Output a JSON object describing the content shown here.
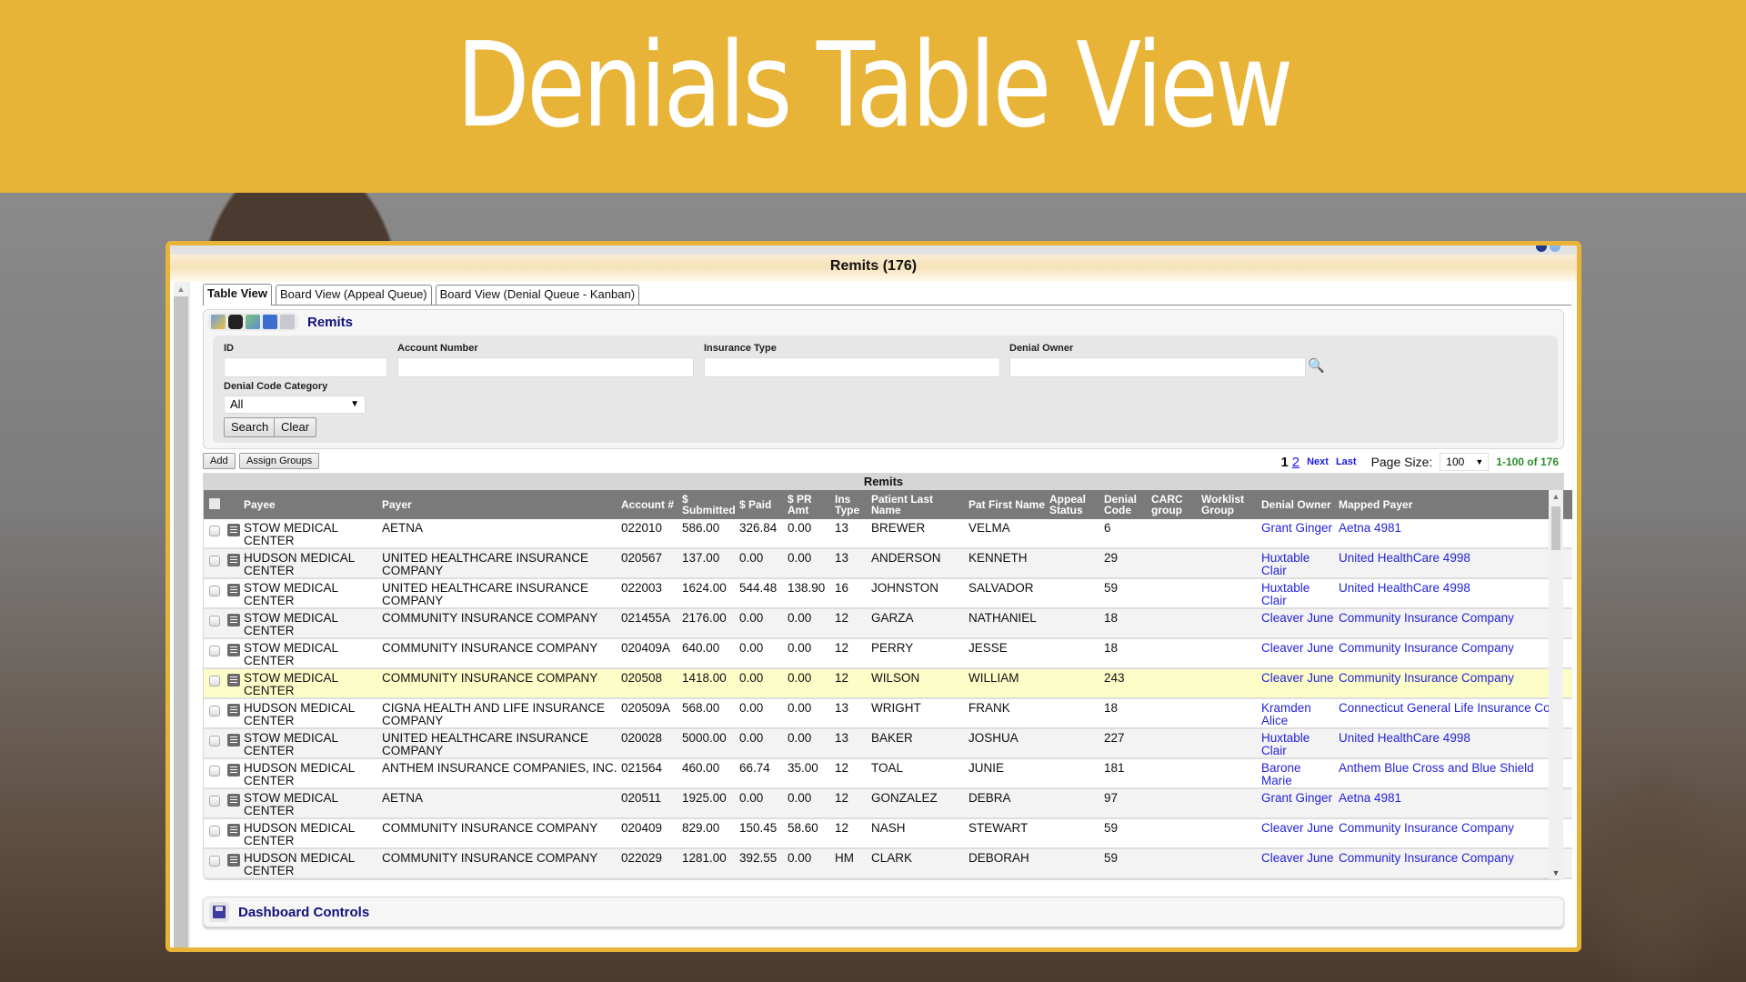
{
  "banner": {
    "title": "Denials Table View"
  },
  "colors": {
    "banner": "#e8b438",
    "link": "#2424d8",
    "title_blue": "#11117a",
    "range_green": "#2a8a2a",
    "highlight_row": "#fdfdc8"
  },
  "window": {
    "title": "Remits (176)"
  },
  "tabs": [
    {
      "label": "Table View",
      "active": true
    },
    {
      "label": "Board View (Appeal Queue)",
      "active": false
    },
    {
      "label": "Board View (Denial Queue - Kanban)",
      "active": false
    }
  ],
  "toolbar": {
    "icons": [
      "edit-icon",
      "binoculars-icon",
      "export-excel-icon",
      "save-icon",
      "checklist-icon"
    ],
    "title": "Remits"
  },
  "filters": {
    "id_label": "ID",
    "id_value": "",
    "account_label": "Account Number",
    "account_value": "",
    "insurance_label": "Insurance Type",
    "insurance_value": "",
    "owner_label": "Denial Owner",
    "owner_value": "",
    "category_label": "Denial Code Category",
    "category_value": "All",
    "search_label": "Search",
    "clear_label": "Clear"
  },
  "actions": {
    "add_label": "Add",
    "assign_label": "Assign Groups"
  },
  "pager": {
    "current": "1",
    "page2": "2",
    "next": "Next",
    "last": "Last",
    "page_size_label": "Page Size:",
    "page_size": "100",
    "range": "1-100 of 176"
  },
  "grid": {
    "caption": "Remits",
    "columns": [
      "Payee",
      "Payer",
      "Account #",
      "$ Submitted",
      "$ Paid",
      "$ PR Amt",
      "Ins Type",
      "Patient Last Name",
      "Pat First Name",
      "Appeal Status",
      "Denial Code",
      "CARC group",
      "Worklist Group",
      "Denial Owner",
      "Mapped Payer"
    ],
    "rows": [
      {
        "payee": "STOW MEDICAL CENTER",
        "payer": "AETNA",
        "account": "022010",
        "submitted": "586.00",
        "paid": "326.84",
        "pr": "0.00",
        "ins": "13",
        "last": "BREWER",
        "first": "VELMA",
        "appeal": "",
        "code": "6",
        "carc": "",
        "worklist": "",
        "owner": "Grant Ginger",
        "mapped": "Aetna 4981",
        "highlight": false
      },
      {
        "payee": "HUDSON MEDICAL CENTER",
        "payer": "UNITED HEALTHCARE INSURANCE COMPANY",
        "account": "020567",
        "submitted": "137.00",
        "paid": "0.00",
        "pr": "0.00",
        "ins": "13",
        "last": "ANDERSON",
        "first": "KENNETH",
        "appeal": "",
        "code": "29",
        "carc": "",
        "worklist": "",
        "owner": "Huxtable Clair",
        "mapped": "United HealthCare 4998",
        "highlight": false
      },
      {
        "payee": "STOW MEDICAL CENTER",
        "payer": "UNITED HEALTHCARE INSURANCE COMPANY",
        "account": "022003",
        "submitted": "1624.00",
        "paid": "544.48",
        "pr": "138.90",
        "ins": "16",
        "last": "JOHNSTON",
        "first": "SALVADOR",
        "appeal": "",
        "code": "59",
        "carc": "",
        "worklist": "",
        "owner": "Huxtable Clair",
        "mapped": "United HealthCare 4998",
        "highlight": false
      },
      {
        "payee": "STOW MEDICAL CENTER",
        "payer": "COMMUNITY INSURANCE COMPANY",
        "account": "021455A",
        "submitted": "2176.00",
        "paid": "0.00",
        "pr": "0.00",
        "ins": "12",
        "last": "GARZA",
        "first": "NATHANIEL",
        "appeal": "",
        "code": "18",
        "carc": "",
        "worklist": "",
        "owner": "Cleaver June",
        "mapped": "Community Insurance Company",
        "highlight": false
      },
      {
        "payee": "STOW MEDICAL CENTER",
        "payer": "COMMUNITY INSURANCE COMPANY",
        "account": "020409A",
        "submitted": "640.00",
        "paid": "0.00",
        "pr": "0.00",
        "ins": "12",
        "last": "PERRY",
        "first": "JESSE",
        "appeal": "",
        "code": "18",
        "carc": "",
        "worklist": "",
        "owner": "Cleaver June",
        "mapped": "Community Insurance Company",
        "highlight": false
      },
      {
        "payee": "STOW MEDICAL CENTER",
        "payer": "COMMUNITY INSURANCE COMPANY",
        "account": "020508",
        "submitted": "1418.00",
        "paid": "0.00",
        "pr": "0.00",
        "ins": "12",
        "last": "WILSON",
        "first": "WILLIAM",
        "appeal": "",
        "code": "243",
        "carc": "",
        "worklist": "",
        "owner": "Cleaver June",
        "mapped": "Community Insurance Company",
        "highlight": true
      },
      {
        "payee": "HUDSON MEDICAL CENTER",
        "payer": "CIGNA HEALTH AND LIFE INSURANCE COMPANY",
        "account": "020509A",
        "submitted": "568.00",
        "paid": "0.00",
        "pr": "0.00",
        "ins": "13",
        "last": "WRIGHT",
        "first": "FRANK",
        "appeal": "",
        "code": "18",
        "carc": "",
        "worklist": "",
        "owner": "Kramden Alice",
        "mapped": "Connecticut General Life Insurance Co.",
        "highlight": false
      },
      {
        "payee": "STOW MEDICAL CENTER",
        "payer": "UNITED HEALTHCARE INSURANCE COMPANY",
        "account": "020028",
        "submitted": "5000.00",
        "paid": "0.00",
        "pr": "0.00",
        "ins": "13",
        "last": "BAKER",
        "first": "JOSHUA",
        "appeal": "",
        "code": "227",
        "carc": "",
        "worklist": "",
        "owner": "Huxtable Clair",
        "mapped": "United HealthCare 4998",
        "highlight": false
      },
      {
        "payee": "HUDSON MEDICAL CENTER",
        "payer": "ANTHEM INSURANCE COMPANIES, INC.",
        "account": "021564",
        "submitted": "460.00",
        "paid": "66.74",
        "pr": "35.00",
        "ins": "12",
        "last": "TOAL",
        "first": "JUNIE",
        "appeal": "",
        "code": "181",
        "carc": "",
        "worklist": "",
        "owner": "Barone Marie",
        "mapped": "Anthem Blue Cross and Blue Shield",
        "highlight": false
      },
      {
        "payee": "STOW MEDICAL CENTER",
        "payer": "AETNA",
        "account": "020511",
        "submitted": "1925.00",
        "paid": "0.00",
        "pr": "0.00",
        "ins": "12",
        "last": "GONZALEZ",
        "first": "DEBRA",
        "appeal": "",
        "code": "97",
        "carc": "",
        "worklist": "",
        "owner": "Grant Ginger",
        "mapped": "Aetna 4981",
        "highlight": false
      },
      {
        "payee": "HUDSON MEDICAL CENTER",
        "payer": "COMMUNITY INSURANCE COMPANY",
        "account": "020409",
        "submitted": "829.00",
        "paid": "150.45",
        "pr": "58.60",
        "ins": "12",
        "last": "NASH",
        "first": "STEWART",
        "appeal": "",
        "code": "59",
        "carc": "",
        "worklist": "",
        "owner": "Cleaver June",
        "mapped": "Community Insurance Company",
        "highlight": false
      },
      {
        "payee": "HUDSON MEDICAL CENTER",
        "payer": "COMMUNITY INSURANCE COMPANY",
        "account": "022029",
        "submitted": "1281.00",
        "paid": "392.55",
        "pr": "0.00",
        "ins": "HM",
        "last": "CLARK",
        "first": "DEBORAH",
        "appeal": "",
        "code": "59",
        "carc": "",
        "worklist": "",
        "owner": "Cleaver June",
        "mapped": "Community Insurance Company",
        "highlight": false
      }
    ]
  },
  "dashboard": {
    "title": "Dashboard Controls"
  }
}
